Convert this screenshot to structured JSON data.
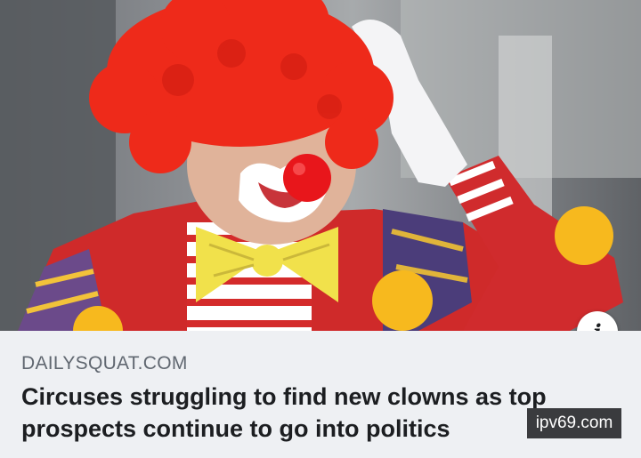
{
  "photo": {
    "subject": "clown-photo",
    "colors": {
      "wig": "#ee2a1a",
      "nose": "#e8161b",
      "bowtie": "#f1e14b",
      "pompom": "#f7b91e",
      "vest": "#d7262a"
    }
  },
  "info_button": {
    "label": "i"
  },
  "link_card": {
    "domain": "DAILYSQUAT.COM",
    "headline": "Circuses struggling to find new clowns as top prospects continue to go into politics"
  },
  "watermark": {
    "text": "ipv69.com"
  }
}
